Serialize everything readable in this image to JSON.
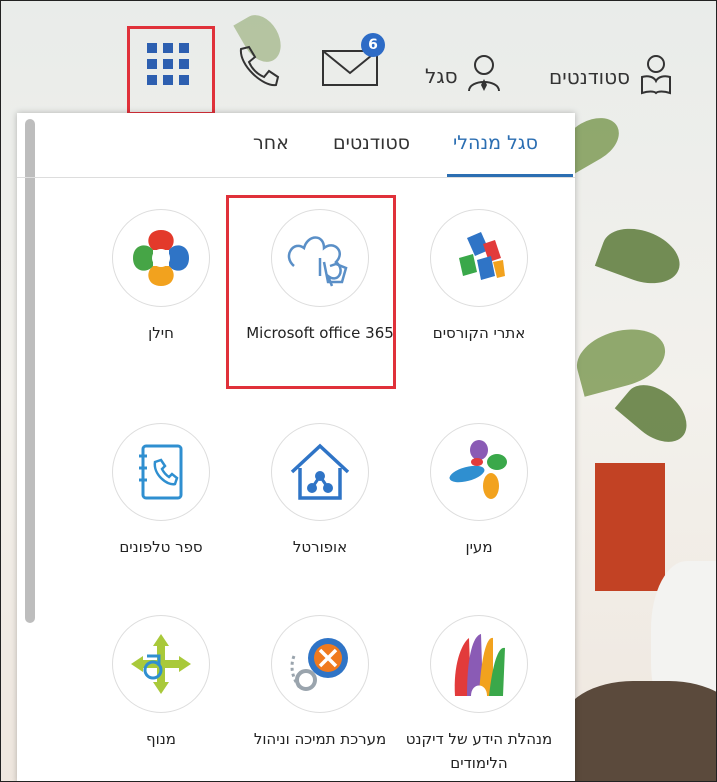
{
  "topbar": {
    "students_label": "סטודנטים",
    "staff_label": "סגל",
    "mail_badge": "6"
  },
  "tabs": [
    {
      "label": "סגל מנהלי",
      "active": true
    },
    {
      "label": "סטודנטים",
      "active": false
    },
    {
      "label": "אחר",
      "active": false
    }
  ],
  "apps": [
    {
      "label": "אתרי הקורסים",
      "icon": "cubes-icon"
    },
    {
      "label": "Microsoft office 365",
      "icon": "hand-touch-icon"
    },
    {
      "label": "חילן",
      "icon": "hilan-logo-icon"
    },
    {
      "label": "מעין",
      "icon": "maayan-logo-icon"
    },
    {
      "label": "אופורטל",
      "icon": "home-network-icon"
    },
    {
      "label": "ספר טלפונים",
      "icon": "phonebook-icon"
    },
    {
      "label": "מנהלת הידע של דיקנט הלימודים",
      "icon": "knowledge-hands-icon"
    },
    {
      "label": "מערכת תמיכה וניהול",
      "icon": "gear-tools-icon"
    },
    {
      "label": "מנוף",
      "icon": "arrows-crane-icon"
    }
  ],
  "colors": {
    "accent": "#2b6eb2",
    "highlight": "#e0313a"
  }
}
